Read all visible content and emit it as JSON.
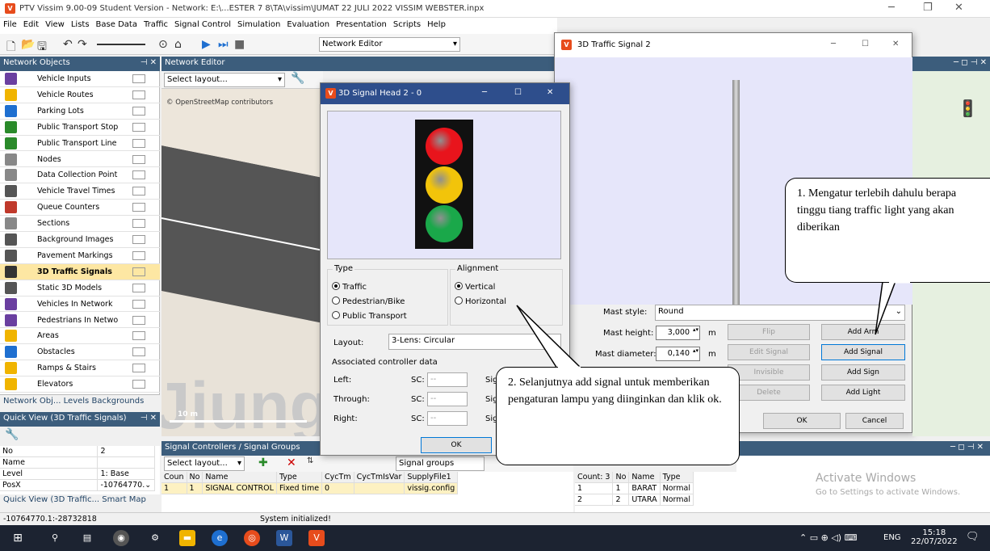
{
  "app": {
    "title": "PTV Vissim 9.00-09 Student Version - Network: E:\\...ESTER 7 8\\TA\\vissim\\JUMAT 22 JULI 2022 VISSIM WEBSTER.inpx",
    "icon": "vissim-logo-icon"
  },
  "menu": [
    "File",
    "Edit",
    "View",
    "Lists",
    "Base Data",
    "Traffic",
    "Signal Control",
    "Simulation",
    "Evaluation",
    "Presentation",
    "Scripts",
    "Help"
  ],
  "toolbar": {
    "editor_combo": "Network Editor"
  },
  "network_objects": {
    "title": "Network Objects",
    "items": [
      {
        "label": "Vehicle Inputs",
        "icon": "vehicle-inputs-icon",
        "color": "#6a3fa0"
      },
      {
        "label": "Vehicle Routes",
        "icon": "vehicle-routes-icon",
        "color": "#f0b400"
      },
      {
        "label": "Parking Lots",
        "icon": "parking-icon",
        "color": "#1e6fd0"
      },
      {
        "label": "Public Transport Stop",
        "icon": "pt-stop-icon",
        "color": "#2a8a2a"
      },
      {
        "label": "Public Transport Line",
        "icon": "pt-line-icon",
        "color": "#2a8a2a"
      },
      {
        "label": "Nodes",
        "icon": "nodes-icon",
        "color": "#888888"
      },
      {
        "label": "Data Collection Point",
        "icon": "data-collection-icon",
        "color": "#888888"
      },
      {
        "label": "Vehicle Travel Times",
        "icon": "travel-times-icon",
        "color": "#555555"
      },
      {
        "label": "Queue Counters",
        "icon": "queue-counter-icon",
        "color": "#c0392b"
      },
      {
        "label": "Sections",
        "icon": "sections-icon",
        "color": "#888888"
      },
      {
        "label": "Background Images",
        "icon": "background-images-icon",
        "color": "#555555"
      },
      {
        "label": "Pavement Markings",
        "icon": "pavement-markings-icon",
        "color": "#555555"
      },
      {
        "label": "3D Traffic Signals",
        "icon": "traffic-signal-icon",
        "color": "#333333"
      },
      {
        "label": "Static 3D Models",
        "icon": "static-3d-icon",
        "color": "#555555"
      },
      {
        "label": "Vehicles In Network",
        "icon": "vehicles-network-icon",
        "color": "#6a3fa0"
      },
      {
        "label": "Pedestrians In Netwo",
        "icon": "pedestrians-icon",
        "color": "#6a3fa0"
      },
      {
        "label": "Areas",
        "icon": "areas-icon",
        "color": "#f0b400"
      },
      {
        "label": "Obstacles",
        "icon": "obstacles-icon",
        "color": "#1e6fd0"
      },
      {
        "label": "Ramps & Stairs",
        "icon": "ramps-icon",
        "color": "#f0b400"
      },
      {
        "label": "Elevators",
        "icon": "elevators-icon",
        "color": "#f0b400"
      }
    ],
    "tabs": [
      "Network Obj...",
      "Levels",
      "Backgrounds"
    ]
  },
  "network_editor": {
    "title": "Network Editor",
    "layout_combo": "Select layout...",
    "attribution": "© OpenStreetMap contributors",
    "scale": "10 m"
  },
  "quick_view": {
    "title": "Quick View (3D Traffic Signals)",
    "rows": [
      [
        "No",
        "2"
      ],
      [
        "Name",
        ""
      ],
      [
        "Level",
        "1: Base"
      ],
      [
        "PosX",
        "-10764770.⌄"
      ]
    ],
    "tabs": [
      "Quick View (3D Traffic...",
      "Smart Map"
    ]
  },
  "signal_controllers": {
    "title": "Signal Controllers / Signal Groups",
    "layout_combo": "Select layout...",
    "groups_combo": "Signal groups",
    "columns": [
      "Coun",
      "No",
      "Name",
      "Type",
      "CycTm",
      "CycTmIsVar",
      "SupplyFile1"
    ],
    "rows": [
      [
        "1",
        "1",
        "SIGNAL CONTROL",
        "Fixed time",
        "0",
        "",
        "vissig.config"
      ]
    ],
    "right_columns": [
      "Count: 3",
      "No",
      "Name",
      "Type"
    ],
    "right_rows": [
      [
        "1",
        "1",
        "BARAT",
        "Normal"
      ],
      [
        "2",
        "2",
        "UTARA",
        "Normal"
      ]
    ]
  },
  "status": {
    "coords": "-10764770.1:-28732818",
    "message": "System initialized!"
  },
  "dlg_traffic_signal": {
    "title": "3D Traffic Signal 2",
    "mast_style_label": "Mast style:",
    "mast_style": "Round",
    "mast_height_label": "Mast height:",
    "mast_height": "3,000",
    "mast_height_unit": "m",
    "mast_diameter_label": "Mast diameter:",
    "mast_diameter": "0,140",
    "mast_diameter_unit": "m",
    "buttons": {
      "flip": "Flip",
      "add_arm": "Add Arm",
      "edit_signal": "Edit Signal",
      "add_signal": "Add Signal",
      "invisible": "Invisible",
      "add_sign": "Add Sign",
      "delete": "Delete",
      "add_light": "Add Light",
      "ok": "OK",
      "cancel": "Cancel"
    }
  },
  "dlg_signal_head": {
    "title": "3D Signal Head 2 - 0",
    "type_label": "Type",
    "types": [
      "Traffic",
      "Pedestrian/Bike",
      "Public Transport"
    ],
    "alignment_label": "Alignment",
    "alignments": [
      "Vertical",
      "Horizontal"
    ],
    "layout_label": "Layout:",
    "layout": "3-Lens: Circular",
    "assoc_label": "Associated controller data",
    "rows": [
      {
        "label": "Left:",
        "sc": "SC:",
        "val": "--",
        "sg": "Sig"
      },
      {
        "label": "Through:",
        "sc": "SC:",
        "val": "--",
        "sg": "Sig"
      },
      {
        "label": "Right:",
        "sc": "SC:",
        "val": "--",
        "sg": "Sig"
      }
    ],
    "ok": "OK",
    "lamp_colors": [
      "#e8141c",
      "#f2c40a",
      "#1aa84a"
    ]
  },
  "callouts": {
    "c1": "1. Mengatur terlebih dahulu berapa  tinggu tiang traffic light yang akan diberikan",
    "c2": "2. Selanjutnya add signal untuk memberikan pengaturan lampu yang diinginkan dan klik ok."
  },
  "watermark": {
    "title": "Activate Windows",
    "sub": "Go to Settings to activate Windows."
  },
  "taskbar": {
    "time": "15:18",
    "date": "22/07/2022",
    "lang": "ENG"
  }
}
